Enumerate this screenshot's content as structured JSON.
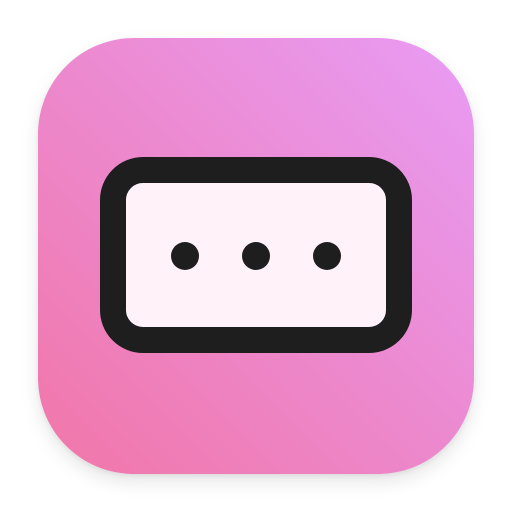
{
  "icon": {
    "name": "more-options-app-icon",
    "glyph": "ellipsis-in-rounded-rectangle",
    "colors": {
      "gradient_bottom_left": "#f176a8",
      "gradient_top_right": "#e89cf5",
      "frame_stroke": "#1e1e1e",
      "panel_fill": "#fff3f9",
      "dot_fill": "#1e1e1e",
      "background": "#ffffff"
    },
    "dot_count": 3
  }
}
